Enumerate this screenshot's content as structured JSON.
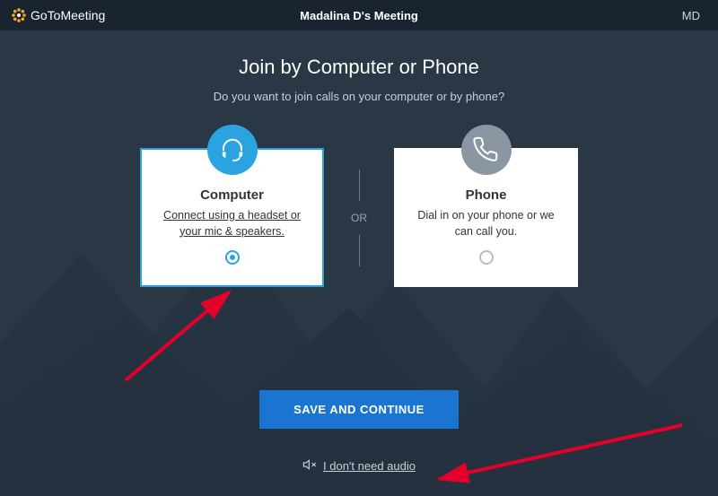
{
  "colors": {
    "accent": "#2aa3e0",
    "primaryButton": "#1a75d1",
    "topbar": "#1a2430",
    "background": "#2a3744"
  },
  "topbar": {
    "logoPrefix": "GoTo",
    "logoSuffix": "Meeting",
    "title": "Madalina D's Meeting",
    "userInitials": "MD"
  },
  "page": {
    "heading": "Join by Computer or Phone",
    "subheading": "Do you want to join calls on your computer or by phone?"
  },
  "options": {
    "separatorLabel": "OR",
    "computer": {
      "title": "Computer",
      "description": "Connect using a headset or your mic & speakers.",
      "iconName": "headset-icon",
      "selected": true
    },
    "phone": {
      "title": "Phone",
      "description": "Dial in on your phone or we can call you.",
      "iconName": "phone-icon",
      "selected": false
    }
  },
  "actions": {
    "saveLabel": "SAVE AND CONTINUE",
    "noAudioLabel": "I don't need audio"
  },
  "annotations": {
    "arrows": [
      {
        "targetName": "computer-radio"
      },
      {
        "targetName": "no-audio-link"
      }
    ]
  }
}
